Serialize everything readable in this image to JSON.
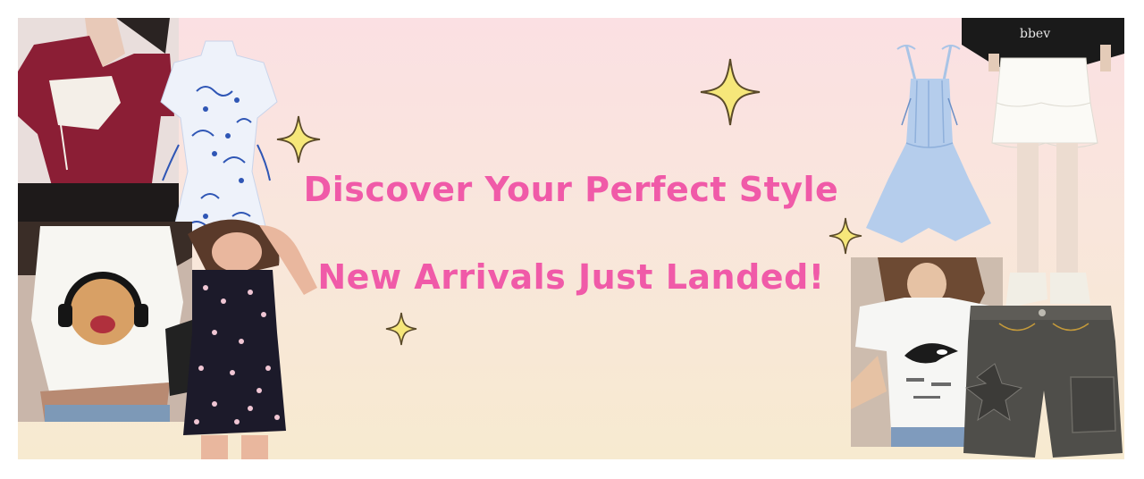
{
  "banner": {
    "headline": "Discover Your Perfect Style",
    "subheadline": "New Arrivals Just Landed!",
    "colors": {
      "headline": "#f05aa8",
      "background_top": "#fbe0e3",
      "background_bottom": "#f7ead0",
      "sparkle_fill": "#f6e77a",
      "sparkle_stroke": "#5a4a2a"
    },
    "sparkles": [
      "sparkle-icon",
      "sparkle-icon",
      "sparkle-icon",
      "sparkle-icon",
      "sparkle-icon"
    ],
    "products": {
      "left": [
        "burgundy-crop-top",
        "blue-floral-qipao-dress",
        "cat-headphones-baby-tee",
        "floral-slip-mini-dress"
      ],
      "right": [
        "graphic-tee-black",
        "blue-corset-sundress",
        "white-tiered-skirt",
        "orca-graphic-baby-tee",
        "grey-denim-cargo-shorts"
      ]
    }
  }
}
